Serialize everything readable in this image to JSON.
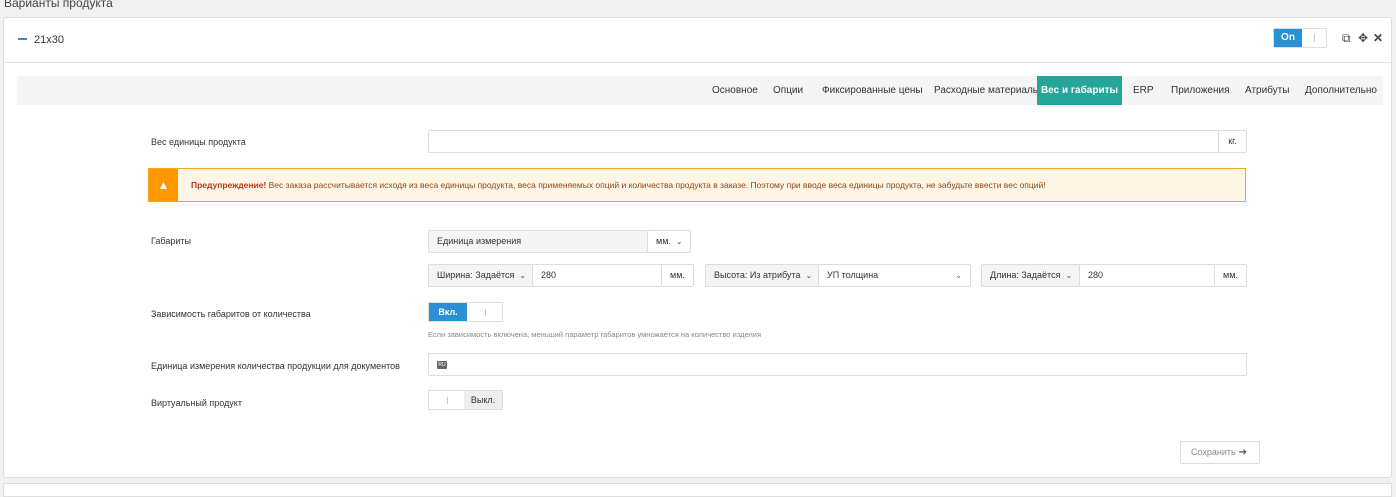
{
  "section_title": "Варианты продукта",
  "variant": {
    "name": "21x30",
    "toggle_label": "On"
  },
  "header_icons": [
    "copy-icon",
    "move-icon",
    "close-icon"
  ],
  "tabs": [
    {
      "label": "Основное",
      "active": false
    },
    {
      "label": "Опции",
      "active": false
    },
    {
      "label": "Фиксированные цены",
      "active": false
    },
    {
      "label": "Расходные материалы",
      "active": false
    },
    {
      "label": "Вес и габариты",
      "active": true
    },
    {
      "label": "ERP",
      "active": false
    },
    {
      "label": "Приложения",
      "active": false
    },
    {
      "label": "Атрибуты",
      "active": false
    },
    {
      "label": "Дополнительно",
      "active": false
    }
  ],
  "weight": {
    "label": "Вес единицы продукта",
    "value": "",
    "unit": "кг."
  },
  "warning": {
    "title": "Предупреждение!",
    "text": " Вес заказа рассчитывается исходя из веса единицы продукта, веса применяемых опций и количества продукта в заказе. Поэтому при вводе веса единицы продукта, не забудьте ввести вес опций!"
  },
  "dimensions": {
    "label": "Габариты",
    "unit_label": "Единица измерения",
    "unit_value": "мм.",
    "width": {
      "mode": "Ширина: Задаётся",
      "value": "280",
      "unit": "мм."
    },
    "height": {
      "mode": "Высота: Из атрибута",
      "attribute": "УП толщина"
    },
    "length": {
      "mode": "Длина: Задаётся",
      "value": "280",
      "unit": "мм."
    }
  },
  "dependency": {
    "label": "Зависимость габаритов от количества",
    "state_label": "Вкл.",
    "hint": "Если зависимость включена, меньший параметр габаритов умножается на количество изделия"
  },
  "doc_unit": {
    "label": "Единица измерения количества продукции для документов",
    "lang": "RU",
    "value": ""
  },
  "virtual": {
    "label": "Виртуальный продукт",
    "state_label": "Выкл."
  },
  "save_label": "Сохранить",
  "colors": {
    "primary": "#2b8fd6",
    "active_tab": "#26a69a",
    "warning": "#ff9800"
  }
}
